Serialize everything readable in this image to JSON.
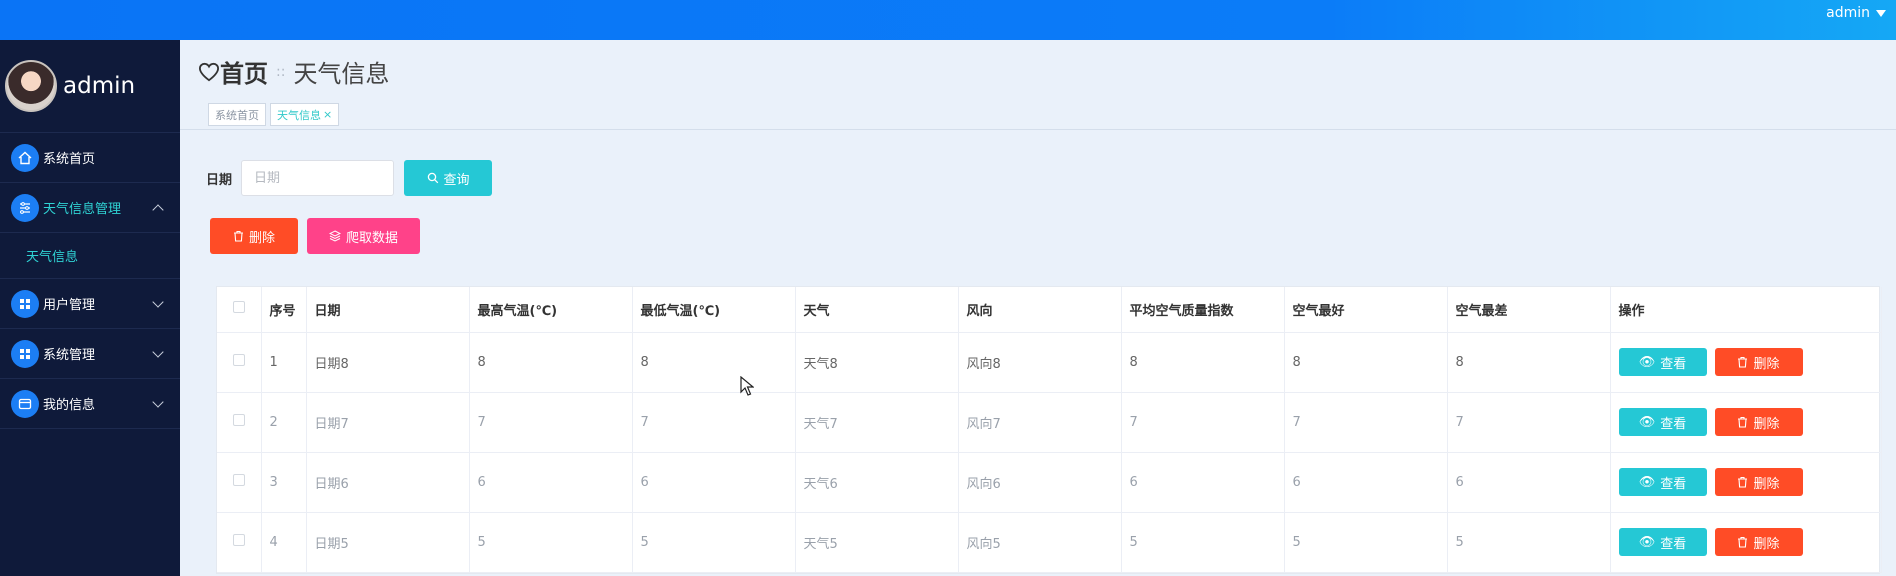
{
  "topbar": {
    "user": "admin"
  },
  "sidebar": {
    "brand": "admin",
    "items": [
      {
        "label": "系统首页",
        "icon": "home-icon",
        "active": false,
        "expandable": false
      },
      {
        "label": "天气信息管理",
        "icon": "sliders-icon",
        "active": true,
        "expandable": true,
        "expanded": true,
        "children": [
          {
            "label": "天气信息"
          }
        ]
      },
      {
        "label": "用户管理",
        "icon": "grid-icon",
        "active": false,
        "expandable": true
      },
      {
        "label": "系统管理",
        "icon": "grid-icon",
        "active": false,
        "expandable": true
      },
      {
        "label": "我的信息",
        "icon": "card-icon",
        "active": false,
        "expandable": true
      }
    ]
  },
  "header": {
    "home": "首页",
    "separator": "::",
    "current": "天气信息",
    "tags": [
      {
        "label": "系统首页"
      },
      {
        "label": "天气信息",
        "closable": "×"
      }
    ]
  },
  "search": {
    "label": "日期",
    "placeholder": "日期",
    "button": "查询"
  },
  "actions": {
    "delete": "删除",
    "crawl": "爬取数据"
  },
  "table": {
    "columns": [
      "序号",
      "日期",
      "最高气温(℃)",
      "最低气温(℃)",
      "天气",
      "风向",
      "平均空气质量指数",
      "空气最好",
      "空气最差",
      "操作"
    ],
    "rows": [
      [
        "1",
        "日期8",
        "8",
        "8",
        "天气8",
        "风向8",
        "8",
        "8",
        "8"
      ],
      [
        "2",
        "日期7",
        "7",
        "7",
        "天气7",
        "风向7",
        "7",
        "7",
        "7"
      ],
      [
        "3",
        "日期6",
        "6",
        "6",
        "天气6",
        "风向6",
        "6",
        "6",
        "6"
      ],
      [
        "4",
        "日期5",
        "5",
        "5",
        "天气5",
        "风向5",
        "5",
        "5",
        "5"
      ]
    ],
    "view_label": "查看",
    "delete_label": "删除"
  },
  "colors": {
    "primary": "#0b7cf8",
    "sidebar_bg": "#0f1a3a",
    "teal": "#25c8d5",
    "danger": "#ff4c26",
    "pink": "#ff4289"
  }
}
